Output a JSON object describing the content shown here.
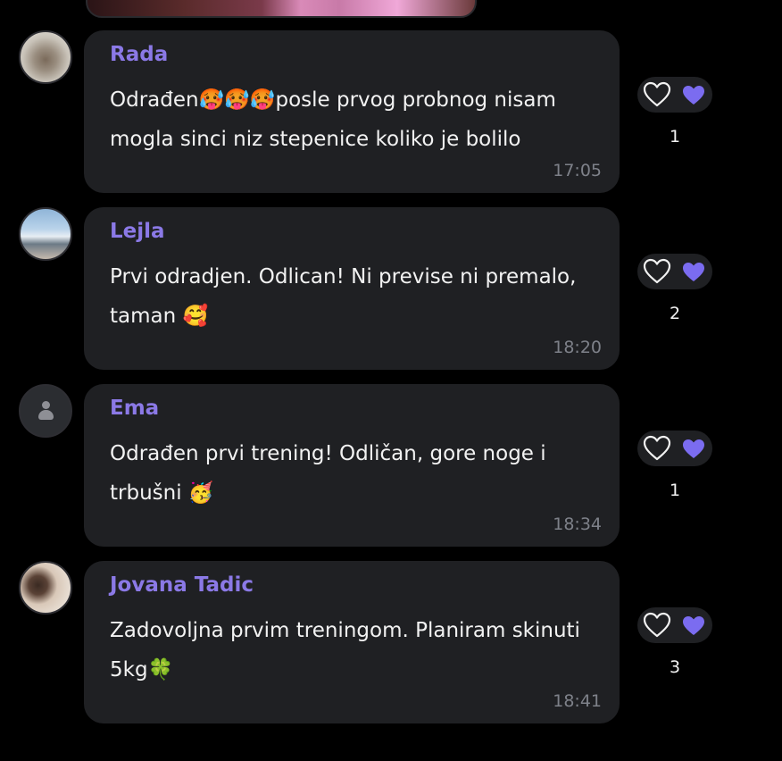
{
  "messages": [
    {
      "author": "Rada",
      "line1": "Odrađen🥵🥵🥵posle prvog probnog nisam",
      "line2": "mogla sinci niz stepenice koliko je bolilo",
      "time": "17:05",
      "reaction_count": "1",
      "avatar": "photo"
    },
    {
      "author": "Lejla",
      "line1": "Prvi odradjen. Odlican! Ni previse ni premalo,",
      "line2": "taman 🥰",
      "time": "18:20",
      "reaction_count": "2",
      "avatar": "photo"
    },
    {
      "author": "Ema",
      "line1": "Odrađen prvi trening! Odličan, gore noge i",
      "line2": "trbušni 🥳",
      "time": "18:34",
      "reaction_count": "1",
      "avatar": "placeholder"
    },
    {
      "author": "Jovana Tadic",
      "line1": "Zadovoljna prvim treningom. Planiram skinuti",
      "line2": "5kg🍀",
      "time": "18:41",
      "reaction_count": "3",
      "avatar": "photo"
    }
  ],
  "icons": {
    "like_outline": "heart-outline-icon",
    "reaction_filled": "heart-icon",
    "placeholder_avatar": "person-icon"
  },
  "colors": {
    "background": "#000000",
    "bubble": "#1f2023",
    "author_name": "#8b79e6",
    "heart_filled": "#7b6cf0",
    "timestamp": "#7e8189"
  }
}
